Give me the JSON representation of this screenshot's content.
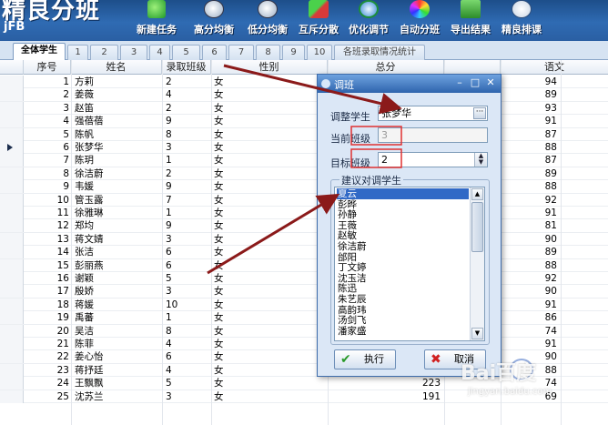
{
  "app": {
    "title": "精良分班",
    "subtitle": "jFB"
  },
  "toolbar": [
    {
      "label": "新建任务",
      "icon": "new-task-icon"
    },
    {
      "label": "高分均衡",
      "icon": "clock-icon"
    },
    {
      "label": "低分均衡",
      "icon": "clock-icon"
    },
    {
      "label": "互斥分散",
      "icon": "swap-icon"
    },
    {
      "label": "优化调节",
      "icon": "optimize-icon"
    },
    {
      "label": "自动分班",
      "icon": "color-wheel-icon"
    },
    {
      "label": "导出结果",
      "icon": "export-icon"
    },
    {
      "label": "精良排课",
      "icon": "schedule-icon"
    }
  ],
  "tabs": [
    "全体学生",
    "1",
    "2",
    "3",
    "4",
    "5",
    "6",
    "7",
    "8",
    "9",
    "10",
    "各班录取情况统计"
  ],
  "active_tab": "全体学生",
  "grid": {
    "headers": [
      "序号",
      "姓名",
      "录取班级",
      "性别",
      "总分",
      "语文"
    ],
    "current_row": 6,
    "rows": [
      {
        "no": "1",
        "name": "方莉",
        "class": "2",
        "sex": "女",
        "total": "",
        "chinese": "94"
      },
      {
        "no": "2",
        "name": "姜薇",
        "class": "4",
        "sex": "女",
        "total": "",
        "chinese": "89"
      },
      {
        "no": "3",
        "name": "赵笛",
        "class": "2",
        "sex": "女",
        "total": "",
        "chinese": "93"
      },
      {
        "no": "4",
        "name": "强蓓蓓",
        "class": "9",
        "sex": "女",
        "total": "",
        "chinese": "91"
      },
      {
        "no": "5",
        "name": "陈帆",
        "class": "8",
        "sex": "女",
        "total": "",
        "chinese": "87"
      },
      {
        "no": "6",
        "name": "张梦华",
        "class": "3",
        "sex": "女",
        "total": "",
        "chinese": "88"
      },
      {
        "no": "7",
        "name": "陈玥",
        "class": "1",
        "sex": "女",
        "total": "",
        "chinese": "87"
      },
      {
        "no": "8",
        "name": "徐洁蔚",
        "class": "2",
        "sex": "女",
        "total": "",
        "chinese": "89"
      },
      {
        "no": "9",
        "name": "韦媛",
        "class": "9",
        "sex": "女",
        "total": "",
        "chinese": "88"
      },
      {
        "no": "10",
        "name": "管玉露",
        "class": "7",
        "sex": "女",
        "total": "",
        "chinese": "92"
      },
      {
        "no": "11",
        "name": "徐雅琳",
        "class": "1",
        "sex": "女",
        "total": "",
        "chinese": "91"
      },
      {
        "no": "12",
        "name": "郑均",
        "class": "9",
        "sex": "女",
        "total": "",
        "chinese": "81"
      },
      {
        "no": "13",
        "name": "蒋文婧",
        "class": "3",
        "sex": "女",
        "total": "",
        "chinese": "90"
      },
      {
        "no": "14",
        "name": "张洁",
        "class": "6",
        "sex": "女",
        "total": "",
        "chinese": "89"
      },
      {
        "no": "15",
        "name": "彭丽燕",
        "class": "6",
        "sex": "女",
        "total": "",
        "chinese": "88"
      },
      {
        "no": "16",
        "name": "谢颖",
        "class": "5",
        "sex": "女",
        "total": "",
        "chinese": "92"
      },
      {
        "no": "17",
        "name": "殷娇",
        "class": "3",
        "sex": "女",
        "total": "",
        "chinese": "90"
      },
      {
        "no": "18",
        "name": "蒋媛",
        "class": "10",
        "sex": "女",
        "total": "",
        "chinese": "91"
      },
      {
        "no": "19",
        "name": "禹蕃",
        "class": "1",
        "sex": "女",
        "total": "",
        "chinese": "86"
      },
      {
        "no": "20",
        "name": "吴洁",
        "class": "8",
        "sex": "女",
        "total": "",
        "chinese": "74"
      },
      {
        "no": "21",
        "name": "陈菲",
        "class": "4",
        "sex": "女",
        "total": "",
        "chinese": "91"
      },
      {
        "no": "22",
        "name": "姜心怡",
        "class": "6",
        "sex": "女",
        "total": "",
        "chinese": "90"
      },
      {
        "no": "23",
        "name": "蒋抒廷",
        "class": "4",
        "sex": "女",
        "total": "",
        "chinese": "88"
      },
      {
        "no": "24",
        "name": "王飘飘",
        "class": "5",
        "sex": "女",
        "total": "223",
        "chinese": "74"
      },
      {
        "no": "25",
        "name": "沈苏兰",
        "class": "3",
        "sex": "女",
        "total": "191",
        "chinese": "69"
      }
    ]
  },
  "dialog": {
    "title": "调班",
    "adjust_label": "调整学生",
    "adjust_value": "张梦华",
    "current_label": "当前班级",
    "current_value": "3",
    "target_label": "目标班级",
    "target_value": "2",
    "group_label": "建议对调学生",
    "suggestions": [
      "夏云",
      "彭晔",
      "孙静",
      "王薇",
      "赵敏",
      "徐洁蔚",
      "邰阳",
      "丁文婷",
      "沈玉洁",
      "陈迅",
      "朱艺辰",
      "高韵玮",
      "汤剑飞",
      "潘家盛"
    ],
    "selected_index": 0,
    "ok_label": "执行",
    "cancel_label": "取消"
  },
  "watermark": {
    "text": "Bai百度",
    "sub": "jingyan.baidu.com"
  },
  "colors": {
    "toolbar": "#2f6bb3",
    "selection": "#3169c6",
    "arrow": "#8b1a1a",
    "highlight_box": "#e03030"
  }
}
